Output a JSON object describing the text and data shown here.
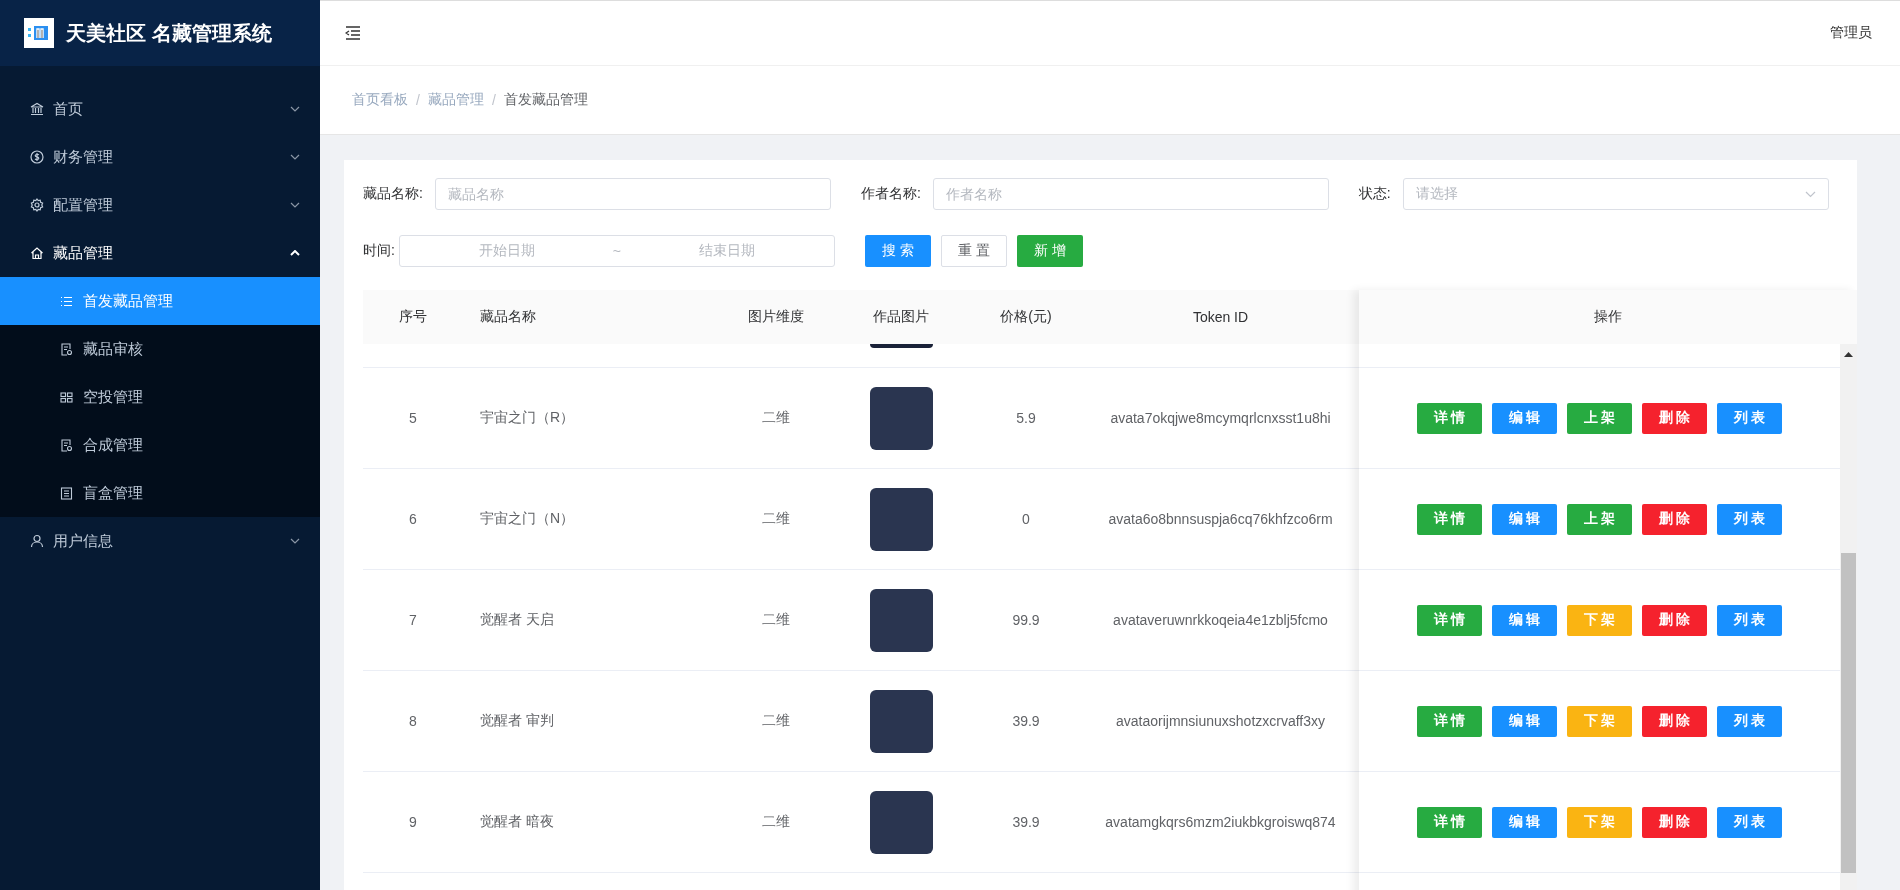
{
  "sidebar": {
    "title": "天美社区 名藏管理系统",
    "items": [
      {
        "label": "首页",
        "expanded": false
      },
      {
        "label": "财务管理",
        "expanded": false
      },
      {
        "label": "配置管理",
        "expanded": false
      },
      {
        "label": "藏品管理",
        "expanded": true,
        "children": [
          {
            "label": "首发藏品管理",
            "selected": true
          },
          {
            "label": "藏品审核",
            "selected": false
          },
          {
            "label": "空投管理",
            "selected": false
          },
          {
            "label": "合成管理",
            "selected": false
          },
          {
            "label": "盲盒管理",
            "selected": false
          }
        ]
      },
      {
        "label": "用户信息",
        "expanded": false
      }
    ]
  },
  "header": {
    "user": "管理员"
  },
  "breadcrumb": [
    {
      "kind": "link",
      "text": "首页看板",
      "current": false
    },
    {
      "kind": "separator",
      "text": "/"
    },
    {
      "kind": "link",
      "text": "藏品管理",
      "current": false
    },
    {
      "kind": "separator",
      "text": "/"
    },
    {
      "kind": "link",
      "text": "首发藏品管理",
      "current": true
    }
  ],
  "filters": {
    "fields": [
      {
        "label": "藏品名称:",
        "placeholder": "藏品名称",
        "kind": "input"
      },
      {
        "label": "作者名称:",
        "placeholder": "作者名称",
        "kind": "input"
      },
      {
        "label": "状态:",
        "placeholder": "请选择",
        "kind": "select"
      }
    ],
    "date": {
      "label": "时间:",
      "start_placeholder": "开始日期",
      "separator": "~",
      "end_placeholder": "结束日期"
    },
    "buttons": [
      {
        "label": "搜 索",
        "kind": "primary"
      },
      {
        "label": "重 置",
        "kind": "default"
      },
      {
        "label": "新 增",
        "kind": "success"
      }
    ]
  },
  "table": {
    "columns": [
      "序号",
      "藏品名称",
      "图片维度",
      "作品图片",
      "价格(元)",
      "Token ID",
      "操作"
    ],
    "rows": [
      {
        "index": "5",
        "name": "宇宙之门（R）",
        "dimension": "二维",
        "price": "5.9",
        "token": "avata7okqjwe8mcymqrlcnxsst1u8hi",
        "actions": [
          {
            "label": "详 情",
            "kind": "success"
          },
          {
            "label": "编 辑",
            "kind": "primary"
          },
          {
            "label": "上 架",
            "kind": "success"
          },
          {
            "label": "删 除",
            "kind": "danger"
          },
          {
            "label": "列 表",
            "kind": "primary"
          }
        ]
      },
      {
        "index": "6",
        "name": "宇宙之门（N）",
        "dimension": "二维",
        "price": "0",
        "token": "avata6o8bnnsuspja6cq76khfzco6rm",
        "actions": [
          {
            "label": "详 情",
            "kind": "success"
          },
          {
            "label": "编 辑",
            "kind": "primary"
          },
          {
            "label": "上 架",
            "kind": "success"
          },
          {
            "label": "删 除",
            "kind": "danger"
          },
          {
            "label": "列 表",
            "kind": "primary"
          }
        ]
      },
      {
        "index": "7",
        "name": "觉醒者 天启",
        "dimension": "二维",
        "price": "99.9",
        "token": "avataveruwnrkkoqeia4e1zblj5fcmo",
        "actions": [
          {
            "label": "详 情",
            "kind": "success"
          },
          {
            "label": "编 辑",
            "kind": "primary"
          },
          {
            "label": "下 架",
            "kind": "warning"
          },
          {
            "label": "删 除",
            "kind": "danger"
          },
          {
            "label": "列 表",
            "kind": "primary"
          }
        ]
      },
      {
        "index": "8",
        "name": "觉醒者 审判",
        "dimension": "二维",
        "price": "39.9",
        "token": "avataorijmnsiunuxshotzxcrvaff3xy",
        "actions": [
          {
            "label": "详 情",
            "kind": "success"
          },
          {
            "label": "编 辑",
            "kind": "primary"
          },
          {
            "label": "下 架",
            "kind": "warning"
          },
          {
            "label": "删 除",
            "kind": "danger"
          },
          {
            "label": "列 表",
            "kind": "primary"
          }
        ]
      },
      {
        "index": "9",
        "name": "觉醒者 暗夜",
        "dimension": "二维",
        "price": "39.9",
        "token": "avatamgkqrs6mzm2iukbkgroiswq874",
        "actions": [
          {
            "label": "详 情",
            "kind": "success"
          },
          {
            "label": "编 辑",
            "kind": "primary"
          },
          {
            "label": "下 架",
            "kind": "warning"
          },
          {
            "label": "删 除",
            "kind": "danger"
          },
          {
            "label": "列 表",
            "kind": "primary"
          }
        ]
      }
    ]
  }
}
